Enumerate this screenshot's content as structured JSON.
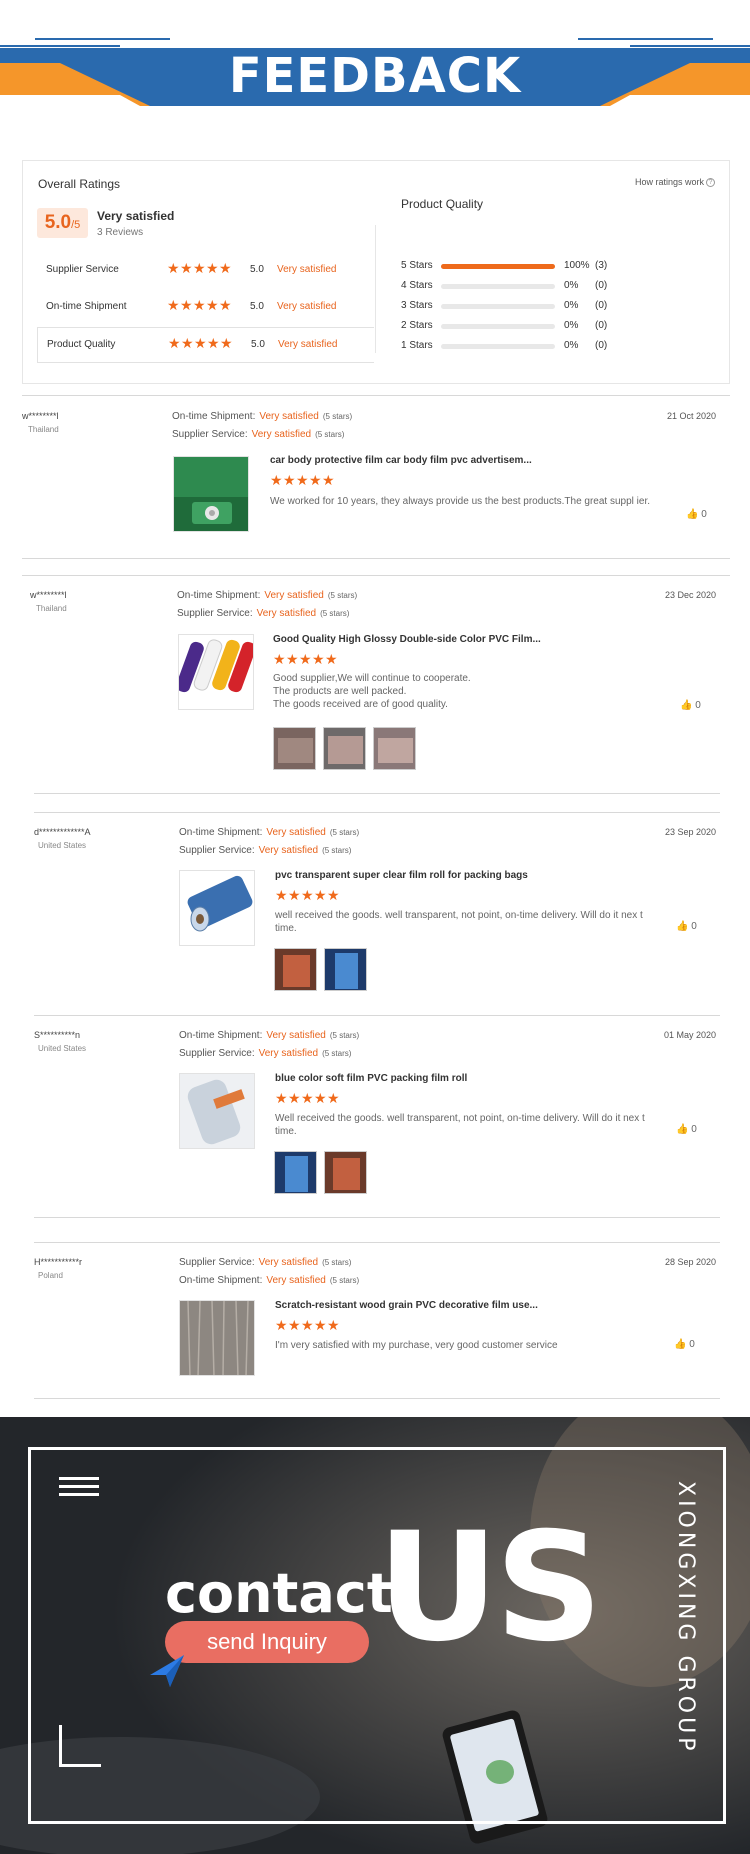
{
  "banner": {
    "title": "FEEDBACK"
  },
  "ratings": {
    "title": "Overall Ratings",
    "how_link": "How ratings work",
    "score": "5.0",
    "score_max": "/5",
    "score_label": "Very satisfied",
    "reviews_count": "3 Reviews",
    "sub": [
      {
        "label": "Supplier Service",
        "value": "5.0",
        "satisfaction": "Very satisfied"
      },
      {
        "label": "On-time Shipment",
        "value": "5.0",
        "satisfaction": "Very satisfied"
      },
      {
        "label": "Product Quality",
        "value": "5.0",
        "satisfaction": "Very satisfied"
      }
    ],
    "pq_title": "Product Quality",
    "bars": [
      {
        "label": "5 Stars",
        "pct": "100%",
        "count": "(3)",
        "fraction": 1.0
      },
      {
        "label": "4 Stars",
        "pct": "0%",
        "count": "(0)",
        "fraction": 0
      },
      {
        "label": "3 Stars",
        "pct": "0%",
        "count": "(0)",
        "fraction": 0
      },
      {
        "label": "2 Stars",
        "pct": "0%",
        "count": "(0)",
        "fraction": 0
      },
      {
        "label": "1 Stars",
        "pct": "0%",
        "count": "(0)",
        "fraction": 0
      }
    ]
  },
  "reviews": [
    {
      "name": "w********l",
      "country": "Thailand",
      "date": "21 Oct 2020",
      "meta": [
        {
          "label": "On-time Shipment:",
          "sat": "Very satisfied",
          "stars": "(5 stars)"
        },
        {
          "label": "Supplier Service:",
          "sat": "Very satisfied",
          "stars": "(5 stars)"
        }
      ],
      "product": "car body protective film car body film pvc advertisem...",
      "text": "We worked for 10 years, they always provide us the best products.The great suppl ier.",
      "likes": "0"
    },
    {
      "name": "w********l",
      "country": "Thailand",
      "date": "23 Dec 2020",
      "meta": [
        {
          "label": "On-time Shipment:",
          "sat": "Very satisfied",
          "stars": "(5 stars)"
        },
        {
          "label": "Supplier Service:",
          "sat": "Very satisfied",
          "stars": "(5 stars)"
        }
      ],
      "product": "Good Quality High Glossy Double-side Color PVC Film...",
      "text": "Good supplier,We will continue to cooperate.\nThe products are well packed.\nThe goods received are of good quality.",
      "likes": "0"
    },
    {
      "name": "d*************A",
      "country": "United States",
      "date": "23 Sep 2020",
      "meta": [
        {
          "label": "On-time Shipment:",
          "sat": "Very satisfied",
          "stars": "(5 stars)"
        },
        {
          "label": "Supplier Service:",
          "sat": "Very satisfied",
          "stars": "(5 stars)"
        }
      ],
      "product": "pvc transparent super clear film roll for packing bags",
      "text": "well received the goods. well transparent, not point, on-time delivery. Will do it nex t time.",
      "likes": "0"
    },
    {
      "name": "S**********n",
      "country": "United States",
      "date": "01 May 2020",
      "meta": [
        {
          "label": "On-time Shipment:",
          "sat": "Very satisfied",
          "stars": "(5 stars)"
        },
        {
          "label": "Supplier Service:",
          "sat": "Very satisfied",
          "stars": "(5 stars)"
        }
      ],
      "product": "blue color soft film PVC packing film roll",
      "text": "Well received the goods. well transparent, not point, on-time delivery. Will do it nex t time.",
      "likes": "0"
    },
    {
      "name": "H***********r",
      "country": "Poland",
      "date": "28 Sep 2020",
      "meta": [
        {
          "label": "Supplier Service:",
          "sat": "Very satisfied",
          "stars": "(5 stars)"
        },
        {
          "label": "On-time Shipment:",
          "sat": "Very satisfied",
          "stars": "(5 stars)"
        }
      ],
      "product": "Scratch-resistant wood grain PVC decorative film use...",
      "text": "I'm very satisfied with my purchase, very good customer service",
      "likes": "0"
    }
  ],
  "contact": {
    "word1": "contact",
    "word2": "US",
    "button": "send Inquiry",
    "group": "XIONGXING GROUP"
  },
  "colors": {
    "accent": "#e8641e",
    "banner_blue": "#2a6aae",
    "banner_orange": "#f5962a"
  }
}
